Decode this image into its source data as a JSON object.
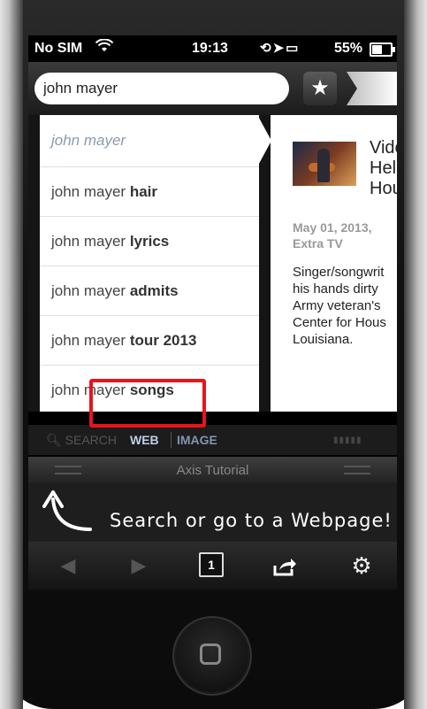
{
  "status_bar": {
    "carrier": "No SIM",
    "time": "19:13",
    "battery": "55%"
  },
  "search": {
    "query": "john mayer"
  },
  "suggestions": [
    {
      "prefix": "john mayer",
      "suffix": ""
    },
    {
      "prefix": "john mayer ",
      "suffix": "hair"
    },
    {
      "prefix": "john mayer ",
      "suffix": "lyrics"
    },
    {
      "prefix": "john mayer ",
      "suffix": "admits"
    },
    {
      "prefix": "john mayer ",
      "suffix": "tour 2013"
    },
    {
      "prefix": "john mayer ",
      "suffix": "songs"
    }
  ],
  "article": {
    "title_lines": [
      "Vide",
      "Hel",
      "Hou"
    ],
    "date": "May 01, 2013,",
    "source": "Extra TV",
    "body_lines": [
      "Singer/songwrit",
      "his hands dirty",
      "Army veteran's",
      "Center for Hous",
      "Louisiana."
    ]
  },
  "scope_tabs": {
    "search": "SEARCH",
    "web": "WEB",
    "image": "IMAGE"
  },
  "tutorial": {
    "title": "Axis Tutorial",
    "message": "Search or go to a Webpage!"
  },
  "toolbar": {
    "tab_count": "1"
  },
  "icons": {
    "star": "star-icon",
    "back": "back-arrow-icon",
    "forward": "forward-arrow-icon",
    "tabs": "tabs-icon",
    "share": "share-icon",
    "settings": "gear-icon"
  },
  "colors": {
    "highlight": "#e8141c",
    "web_tab": "#bcd0e8",
    "image_tab": "#7f95b0"
  }
}
